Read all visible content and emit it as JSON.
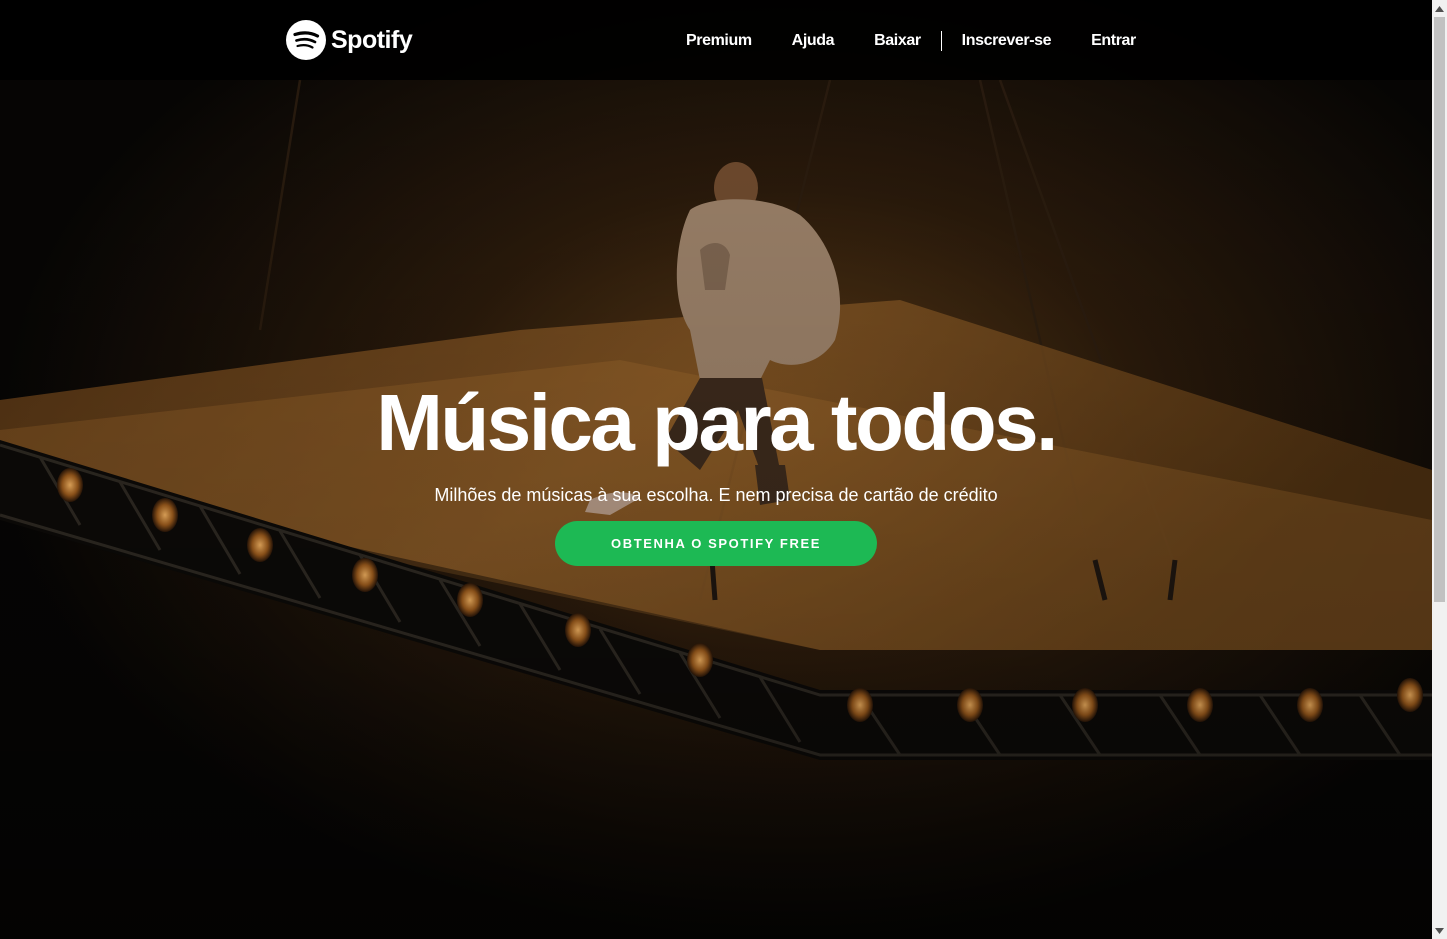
{
  "brand": {
    "name": "Spotify",
    "accent_color": "#1db954"
  },
  "nav": {
    "premium": "Premium",
    "help": "Ajuda",
    "download": "Baixar",
    "signup": "Inscrever-se",
    "login": "Entrar"
  },
  "hero": {
    "title": "Música para todos.",
    "subtitle": "Milhões de músicas à sua escolha. E nem precisa de cartão de crédito",
    "cta_label": "OBTENHA O SPOTIFY FREE",
    "image_description": "artist-on-tilted-lit-stage"
  },
  "icons": {
    "logo": "spotify-logo-icon",
    "scroll_up": "scroll-up-arrow-icon",
    "scroll_down": "scroll-down-arrow-icon"
  }
}
